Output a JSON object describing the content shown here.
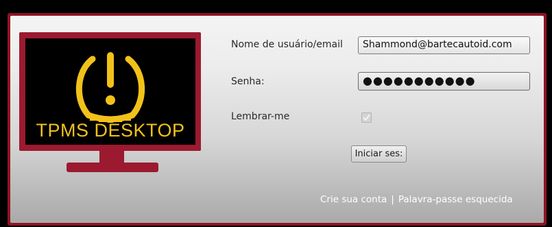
{
  "logo": {
    "text": "TPMS DESKTOP",
    "icon": "tire-pressure-warning-icon",
    "colors": {
      "accent": "#f2c21a",
      "frame": "#9b1a2f",
      "screen": "#000000"
    }
  },
  "form": {
    "username_label": "Nome de usuário/email",
    "username_value": "Shammond@bartecautoid.com",
    "password_label": "Senha:",
    "password_value": "●●●●●●●●●●●",
    "remember_label": "Lembrar-me",
    "remember_checked": true,
    "login_button": "Iniciar ses:"
  },
  "links": {
    "create_account": "Crie sua conta",
    "separator": "|",
    "forgot_password": "Palavra-passe esquecida"
  },
  "colors": {
    "window_border": "#8f1323",
    "link": "#ffffff"
  }
}
